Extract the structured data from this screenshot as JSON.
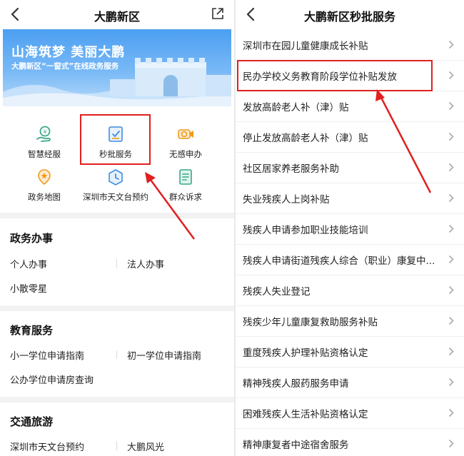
{
  "left": {
    "title": "大鹏新区",
    "banner": {
      "title": "山海筑梦 美丽大鹏",
      "subtitle": "大鹏新区“一窗式”在线政务服务"
    },
    "grid": [
      {
        "label": "智慧经服",
        "icon": "money-hand-icon"
      },
      {
        "label": "秒批服务",
        "icon": "approval-doc-icon"
      },
      {
        "label": "无感申办",
        "icon": "camera-icon"
      },
      {
        "label": "政务地图",
        "icon": "map-pin-icon"
      },
      {
        "label": "深圳市天文台预约",
        "icon": "clock-icon"
      },
      {
        "label": "群众诉求",
        "icon": "list-doc-icon"
      }
    ],
    "sections": [
      {
        "title": "政务办事",
        "items": [
          "个人办事",
          "法人办事",
          "小散零星"
        ]
      },
      {
        "title": "教育服务",
        "items": [
          "小一学位申请指南",
          "初一学位申请指南",
          "公办学位申请房查询"
        ]
      },
      {
        "title": "交通旅游",
        "items": [
          "深圳市天文台预约",
          "大鹏风光"
        ]
      }
    ]
  },
  "right": {
    "title": "大鹏新区秒批服务",
    "items": [
      "深圳市在园儿童健康成长补贴",
      "民办学校义务教育阶段学位补贴发放",
      "发放高龄老人补（津）贴",
      "停止发放高龄老人补（津）贴",
      "社区居家养老服务补助",
      "失业残疾人上岗补贴",
      "残疾人申请参加职业技能培训",
      "残疾人申请街道残疾人综合（职业）康复中...",
      "残疾人失业登记",
      "残疾少年儿童康复救助服务补贴",
      "重度残疾人护理补贴资格认定",
      "精神残疾人服药服务申请",
      "困难残疾人生活补贴资格认定",
      "精神康复者中途宿舍服务"
    ]
  },
  "colors": {
    "accent": "#e02020",
    "icon_green": "#3aa88a",
    "icon_blue": "#3d8ee0",
    "icon_orange": "#f09a1a"
  }
}
